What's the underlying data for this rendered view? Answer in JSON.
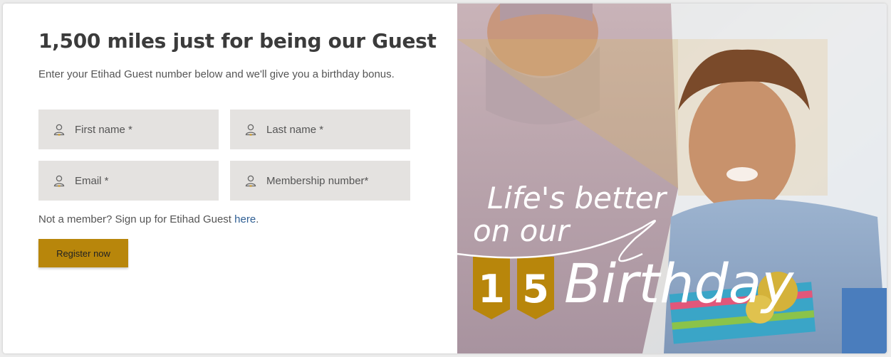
{
  "promo": {
    "title": "1,500 miles just for being our Guest",
    "subtitle": "Enter your Etihad Guest number below and we'll give you a birthday bonus."
  },
  "form": {
    "first_name": "First name *",
    "last_name": "Last name *",
    "email": "Email *",
    "membership": "Membership number*",
    "signup_prefix": "Not a member? Sign up for Etihad Guest ",
    "signup_link": "here",
    "signup_suffix": ".",
    "register_label": "Register now"
  },
  "banner": {
    "line1": "Life's better",
    "line2": "on our",
    "script": "Birthday",
    "digit1": "1",
    "digit2": "5"
  },
  "colors": {
    "accent": "#b8860b",
    "field_bg": "#e4e2e0",
    "link": "#2f5f94"
  },
  "icons": {
    "field": "user-icon"
  }
}
